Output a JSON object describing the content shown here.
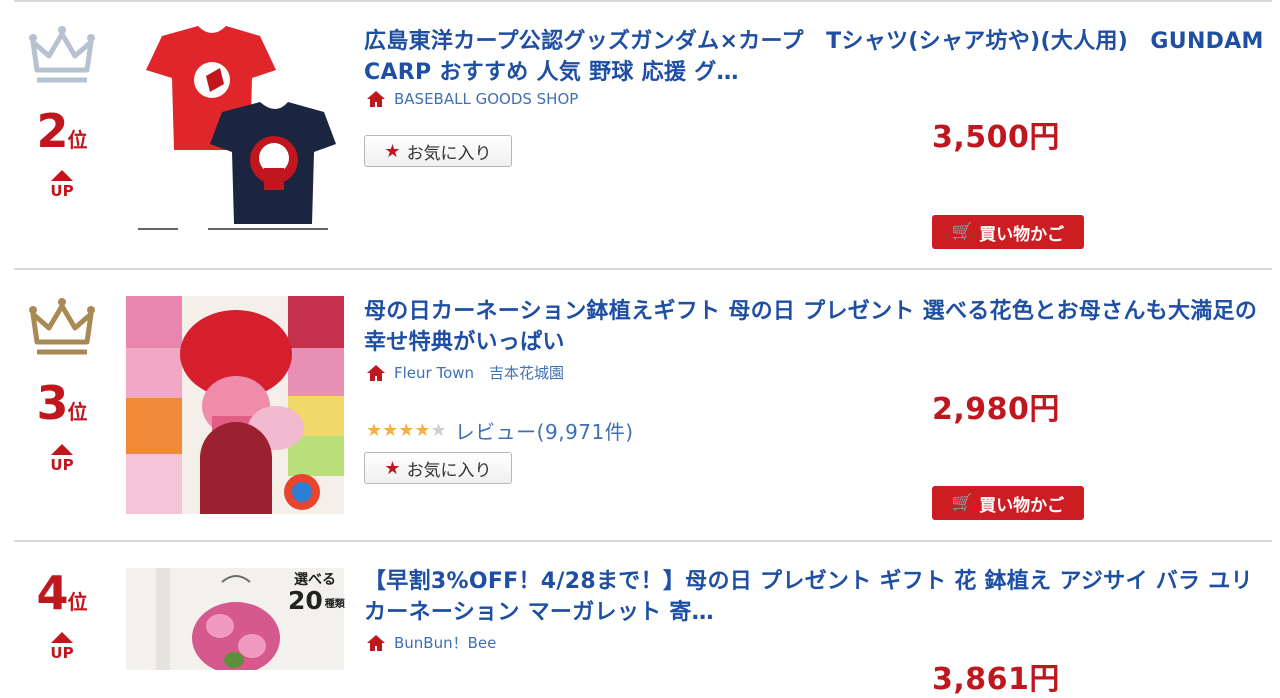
{
  "items": [
    {
      "rank": "2",
      "rank_unit": "位",
      "movement": "UP",
      "title": "広島東洋カープ公認グッズガンダム×カープ　Tシャツ(シャア坊や)(大人用)　GUNDAM CARP おすすめ 人気 野球 応援 グ…",
      "shop": "BASEBALL GOODS SHOP",
      "favorite_label": "お気に入り",
      "price": "3,500円",
      "cart_label": "買い物かご",
      "crown_color": "#b6c2cf"
    },
    {
      "rank": "3",
      "rank_unit": "位",
      "movement": "UP",
      "title": "母の日カーネーション鉢植えギフト 母の日 プレゼント 選べる花色とお母さんも大満足の幸せ特典がいっぱい",
      "shop": "Fleur Town　吉本花城園",
      "rating": 4,
      "review_label": "レビュー(9,971件)",
      "favorite_label": "お気に入り",
      "price": "2,980円",
      "cart_label": "買い物かご",
      "crown_color": "#a98a55"
    },
    {
      "rank": "4",
      "rank_unit": "位",
      "movement": "UP",
      "title": "【早割3%OFF！4/28まで！】母の日 プレゼント ギフト 花 鉢植え アジサイ バラ ユリ カーネーション マーガレット 寄…",
      "shop": "BunBun！Bee",
      "price": "3,861円",
      "thumb_badge_top": "選べる",
      "thumb_badge_num": "20",
      "thumb_badge_unit": "種類"
    }
  ],
  "colors": {
    "accent_red": "#c0161e",
    "link_blue": "#1f4fa3",
    "cart_red": "#cc1d22"
  }
}
